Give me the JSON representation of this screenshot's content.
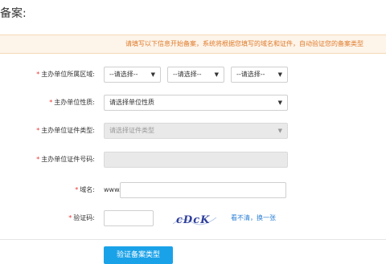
{
  "page": {
    "title": "备案:"
  },
  "banner": {
    "text": "请填写以下信息开始备案，系统将根据您填写的域名和证件，自动验证您的备案类型"
  },
  "form": {
    "required_mark": "*",
    "region": {
      "label": "主办单位所属区域:",
      "province": "--请选择--",
      "city": "--请选择--",
      "district": "--请选择--"
    },
    "nature": {
      "label": "主办单位性质:",
      "value": "请选择单位性质"
    },
    "cert_type": {
      "label": "主办单位证件类型:",
      "placeholder": "请选择证件类型"
    },
    "cert_number": {
      "label": "主办单位证件号码:",
      "value": ""
    },
    "domain": {
      "label": "域名:",
      "prefix": "www.",
      "value": ""
    },
    "captcha": {
      "label": "验证码:",
      "value": "",
      "image_text": "cDcK",
      "refresh_link": "看不清，换一张"
    }
  },
  "actions": {
    "submit_label": "验证备案类型"
  },
  "colors": {
    "accent": "#1aa2e8",
    "banner_text": "#e07b2a",
    "banner_bg": "#fdf4ea",
    "link": "#2a7fd4",
    "required": "#e33333"
  },
  "icons": {
    "select_arrow": "caret-down-icon"
  }
}
